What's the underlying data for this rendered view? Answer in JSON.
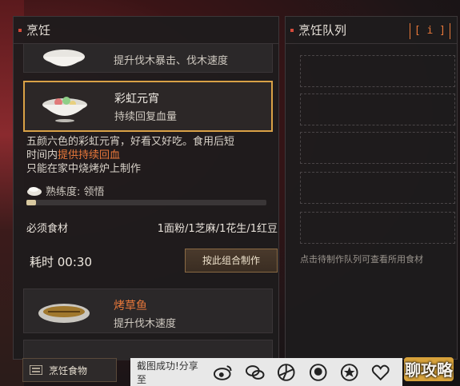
{
  "cooking_panel": {
    "title": "烹饪",
    "foods": [
      {
        "name": "",
        "effect": "提升伐木暴击、伐木速度"
      },
      {
        "name": "彩虹元宵",
        "effect": "持续回复血量"
      },
      {
        "name": "烤草鱼",
        "effect": "提升伐木速度"
      }
    ],
    "description": {
      "line1": "五颜六色的彩虹元宵，好看又好吃。食用后短",
      "line2_prefix": "时间内",
      "line2_highlight": "提供持续回血",
      "line3": "只能在家中烧烤炉上制作"
    },
    "proficiency_label": "熟练度: 领悟",
    "proficiency_level": 0.04,
    "ingredients_label": "必须食材",
    "ingredients_value": "1面粉/1芝麻/1花生/1红豆",
    "time_label": "耗时 00:30",
    "make_button": "按此组合制作"
  },
  "queue_panel": {
    "title": "烹饪队列",
    "info_button": "[ i ]",
    "hint": "点击待制作队列可查看所用食材"
  },
  "bottom": {
    "cook_food_button": "烹饪食物",
    "share_label": "截图成功!分享至",
    "share_icons": [
      "weibo-icon",
      "wechat-icon",
      "moments-icon",
      "qq-icon",
      "qzone-icon",
      "heart-icon"
    ]
  },
  "watermark": "聊攻略",
  "colors": {
    "accent_orange": "#e8783a",
    "selected_border": "#d9a146"
  }
}
